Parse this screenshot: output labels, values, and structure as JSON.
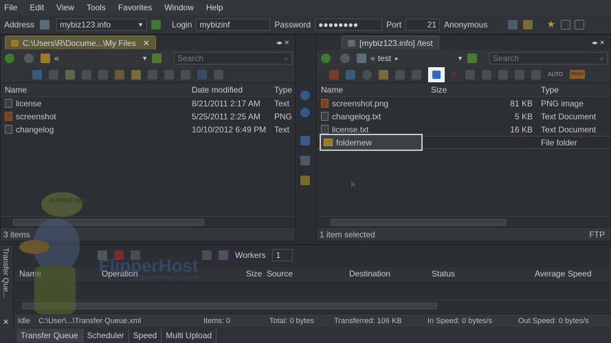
{
  "menu": [
    "File",
    "Edit",
    "View",
    "Tools",
    "Favorites",
    "Window",
    "Help"
  ],
  "address": {
    "label": "Address",
    "host": "mybiz123.info",
    "login_label": "Login",
    "login": "mybizinf",
    "password_label": "Password",
    "password": "●●●●●●●●",
    "port_label": "Port",
    "port": "21",
    "mode": "Anonymous"
  },
  "left_pane": {
    "tab": "C:\\Users\\R\\Docume...\\My Files",
    "path": "«",
    "search_placeholder": "Search",
    "columns": [
      "Name",
      "Date modified",
      "Type"
    ],
    "rows": [
      {
        "name": "license",
        "date": "8/21/2011 2:17 AM",
        "type": "Text",
        "icon": "text-file-icon"
      },
      {
        "name": "screenshot",
        "date": "5/25/2011 2:25 AM",
        "type": "PNG",
        "icon": "image-file-icon"
      },
      {
        "name": "changelog",
        "date": "10/10/2012 6:49 PM",
        "type": "Text",
        "icon": "text-file-icon"
      }
    ],
    "status": "3 items"
  },
  "right_pane": {
    "tab": "[mybiz123.info] /test",
    "path_prefix": "«",
    "path": "test",
    "search_placeholder": "Search",
    "columns": [
      "Name",
      "Size",
      "Type"
    ],
    "rows": [
      {
        "name": "screenshot.png",
        "size": "81 KB",
        "type": "PNG image",
        "icon": "image-file-icon"
      },
      {
        "name": "changelog.txt",
        "size": "5 KB",
        "type": "Text Document",
        "icon": "text-file-icon"
      },
      {
        "name": "license.txt",
        "size": "16 KB",
        "type": "Text Document",
        "icon": "text-file-icon"
      },
      {
        "name": "foldernew",
        "size": "",
        "type": "File folder",
        "icon": "folder-icon"
      }
    ],
    "status": "1 item selected",
    "protocol": "FTP",
    "pasv": "PASV",
    "auto": "AUTO"
  },
  "queue": {
    "side_label": "Transfer Que...",
    "workers_label": "Workers",
    "workers": "1",
    "columns": [
      "Name",
      "Operation",
      "Size",
      "Source",
      "Destination",
      "Status",
      "Average Speed"
    ],
    "status": {
      "state": "Idle",
      "file": "C:\\User\\...\\Transfer Queue.xml",
      "items": "Items: 0",
      "total": "Total: 0 bytes",
      "transferred": "Transferred: 106 KB",
      "in_speed": "In Speed: 0 bytes/s",
      "out_speed": "Out Speed: 0 bytes/s"
    }
  },
  "bottom_tabs": [
    "Transfer Queue",
    "Scheduler",
    "Speed",
    "Multi Upload"
  ],
  "watermark": {
    "brand": "FlipperHost",
    "cap": "FLIPPER HOST",
    "tagline": "A ZEN INTERNET COMPANY"
  },
  "colors": {
    "accent": "#8a7a2a",
    "highlight": "#2f68c8"
  }
}
